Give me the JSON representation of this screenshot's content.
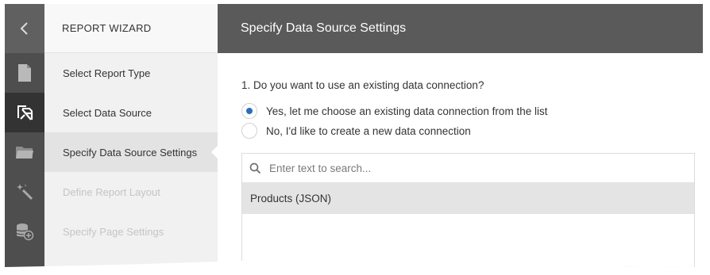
{
  "wizard": {
    "title": "REPORT WIZARD",
    "rail_icons": [
      {
        "icon": "chevron-left-icon"
      },
      {
        "icon": "document-icon",
        "active": false
      },
      {
        "icon": "data-source-icon",
        "active": true
      },
      {
        "icon": "folder-icon",
        "active": false
      },
      {
        "icon": "magic-wand-icon",
        "active": false
      },
      {
        "icon": "database-add-icon",
        "active": false
      }
    ],
    "steps": [
      {
        "label": "Select Report Type",
        "state": "done"
      },
      {
        "label": "Select Data Source",
        "state": "done"
      },
      {
        "label": "Specify Data Source Settings",
        "state": "active"
      },
      {
        "label": "Define Report Layout",
        "state": "disabled"
      },
      {
        "label": "Specify Page Settings",
        "state": "disabled"
      }
    ]
  },
  "main": {
    "header": "Specify Data Source Settings",
    "question": "1. Do you want to use an existing data connection?",
    "options": [
      {
        "label": "Yes, let me choose an existing data connection from the list",
        "checked": true
      },
      {
        "label": "No, I'd like to create a new data connection",
        "checked": false
      }
    ],
    "search": {
      "placeholder": "Enter text to search...",
      "value": ""
    },
    "connections": [
      {
        "label": "Products (JSON)",
        "selected": true
      }
    ]
  },
  "colors": {
    "accent": "#2c6dbd",
    "header_bg": "#5a5a5a",
    "rail_bg": "#4e4e4e"
  }
}
